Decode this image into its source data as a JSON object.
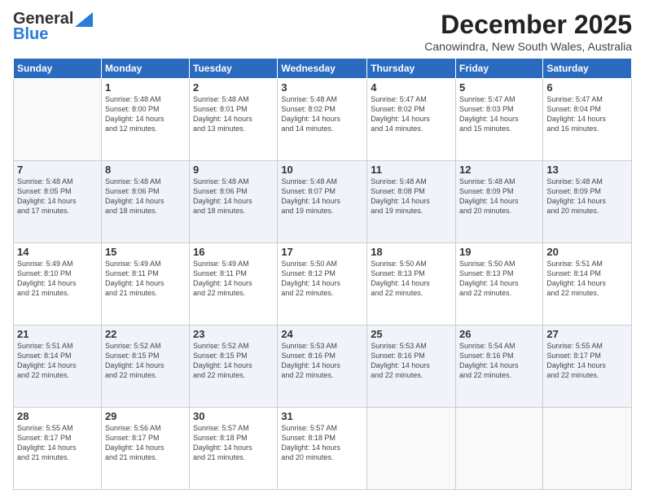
{
  "logo": {
    "line1": "General",
    "line2": "Blue"
  },
  "title": "December 2025",
  "subtitle": "Canowindra, New South Wales, Australia",
  "days_of_week": [
    "Sunday",
    "Monday",
    "Tuesday",
    "Wednesday",
    "Thursday",
    "Friday",
    "Saturday"
  ],
  "weeks": [
    [
      {
        "num": "",
        "info": ""
      },
      {
        "num": "1",
        "info": "Sunrise: 5:48 AM\nSunset: 8:00 PM\nDaylight: 14 hours\nand 12 minutes."
      },
      {
        "num": "2",
        "info": "Sunrise: 5:48 AM\nSunset: 8:01 PM\nDaylight: 14 hours\nand 13 minutes."
      },
      {
        "num": "3",
        "info": "Sunrise: 5:48 AM\nSunset: 8:02 PM\nDaylight: 14 hours\nand 14 minutes."
      },
      {
        "num": "4",
        "info": "Sunrise: 5:47 AM\nSunset: 8:02 PM\nDaylight: 14 hours\nand 14 minutes."
      },
      {
        "num": "5",
        "info": "Sunrise: 5:47 AM\nSunset: 8:03 PM\nDaylight: 14 hours\nand 15 minutes."
      },
      {
        "num": "6",
        "info": "Sunrise: 5:47 AM\nSunset: 8:04 PM\nDaylight: 14 hours\nand 16 minutes."
      }
    ],
    [
      {
        "num": "7",
        "info": "Sunrise: 5:48 AM\nSunset: 8:05 PM\nDaylight: 14 hours\nand 17 minutes."
      },
      {
        "num": "8",
        "info": "Sunrise: 5:48 AM\nSunset: 8:06 PM\nDaylight: 14 hours\nand 18 minutes."
      },
      {
        "num": "9",
        "info": "Sunrise: 5:48 AM\nSunset: 8:06 PM\nDaylight: 14 hours\nand 18 minutes."
      },
      {
        "num": "10",
        "info": "Sunrise: 5:48 AM\nSunset: 8:07 PM\nDaylight: 14 hours\nand 19 minutes."
      },
      {
        "num": "11",
        "info": "Sunrise: 5:48 AM\nSunset: 8:08 PM\nDaylight: 14 hours\nand 19 minutes."
      },
      {
        "num": "12",
        "info": "Sunrise: 5:48 AM\nSunset: 8:09 PM\nDaylight: 14 hours\nand 20 minutes."
      },
      {
        "num": "13",
        "info": "Sunrise: 5:48 AM\nSunset: 8:09 PM\nDaylight: 14 hours\nand 20 minutes."
      }
    ],
    [
      {
        "num": "14",
        "info": "Sunrise: 5:49 AM\nSunset: 8:10 PM\nDaylight: 14 hours\nand 21 minutes."
      },
      {
        "num": "15",
        "info": "Sunrise: 5:49 AM\nSunset: 8:11 PM\nDaylight: 14 hours\nand 21 minutes."
      },
      {
        "num": "16",
        "info": "Sunrise: 5:49 AM\nSunset: 8:11 PM\nDaylight: 14 hours\nand 22 minutes."
      },
      {
        "num": "17",
        "info": "Sunrise: 5:50 AM\nSunset: 8:12 PM\nDaylight: 14 hours\nand 22 minutes."
      },
      {
        "num": "18",
        "info": "Sunrise: 5:50 AM\nSunset: 8:13 PM\nDaylight: 14 hours\nand 22 minutes."
      },
      {
        "num": "19",
        "info": "Sunrise: 5:50 AM\nSunset: 8:13 PM\nDaylight: 14 hours\nand 22 minutes."
      },
      {
        "num": "20",
        "info": "Sunrise: 5:51 AM\nSunset: 8:14 PM\nDaylight: 14 hours\nand 22 minutes."
      }
    ],
    [
      {
        "num": "21",
        "info": "Sunrise: 5:51 AM\nSunset: 8:14 PM\nDaylight: 14 hours\nand 22 minutes."
      },
      {
        "num": "22",
        "info": "Sunrise: 5:52 AM\nSunset: 8:15 PM\nDaylight: 14 hours\nand 22 minutes."
      },
      {
        "num": "23",
        "info": "Sunrise: 5:52 AM\nSunset: 8:15 PM\nDaylight: 14 hours\nand 22 minutes."
      },
      {
        "num": "24",
        "info": "Sunrise: 5:53 AM\nSunset: 8:16 PM\nDaylight: 14 hours\nand 22 minutes."
      },
      {
        "num": "25",
        "info": "Sunrise: 5:53 AM\nSunset: 8:16 PM\nDaylight: 14 hours\nand 22 minutes."
      },
      {
        "num": "26",
        "info": "Sunrise: 5:54 AM\nSunset: 8:16 PM\nDaylight: 14 hours\nand 22 minutes."
      },
      {
        "num": "27",
        "info": "Sunrise: 5:55 AM\nSunset: 8:17 PM\nDaylight: 14 hours\nand 22 minutes."
      }
    ],
    [
      {
        "num": "28",
        "info": "Sunrise: 5:55 AM\nSunset: 8:17 PM\nDaylight: 14 hours\nand 21 minutes."
      },
      {
        "num": "29",
        "info": "Sunrise: 5:56 AM\nSunset: 8:17 PM\nDaylight: 14 hours\nand 21 minutes."
      },
      {
        "num": "30",
        "info": "Sunrise: 5:57 AM\nSunset: 8:18 PM\nDaylight: 14 hours\nand 21 minutes."
      },
      {
        "num": "31",
        "info": "Sunrise: 5:57 AM\nSunset: 8:18 PM\nDaylight: 14 hours\nand 20 minutes."
      },
      {
        "num": "",
        "info": ""
      },
      {
        "num": "",
        "info": ""
      },
      {
        "num": "",
        "info": ""
      }
    ]
  ]
}
